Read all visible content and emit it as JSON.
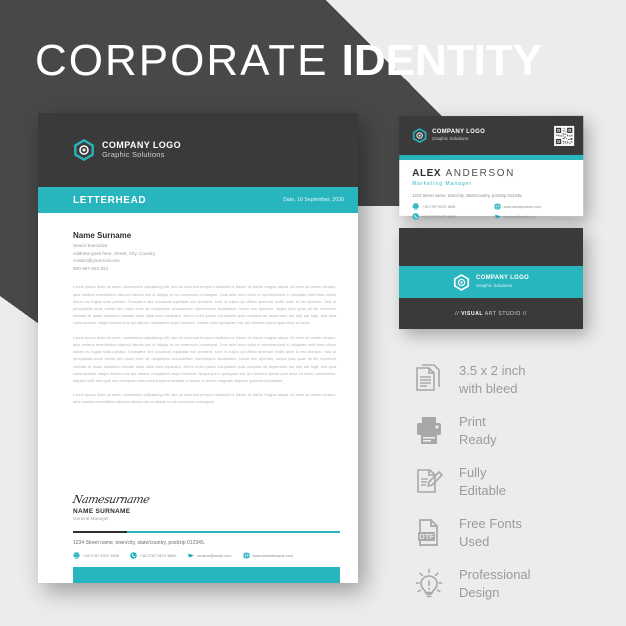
{
  "title": {
    "light": "CORPORATE",
    "bold": "IDENTITY"
  },
  "brand": {
    "accent": "#27b5be",
    "dark": "#3a3a3a",
    "background": "#484848",
    "logo_name": "COMPANY LOGO",
    "logo_tagline": "Graphic Solutions"
  },
  "letterhead": {
    "section_label": "LETTERHEAD",
    "date": "Date, 10 September, 2030",
    "recipient": {
      "name": "Name Surname",
      "role": "Senior Executive",
      "address": "Address goes here, Street, City, Country",
      "email": "contact@yourmail.com",
      "phone": "000-987-654-321"
    },
    "paragraphs": [
      "Lorem ipsum dolor sit amet, consectetur adipisicing elit, sed do eiusmod tempor incididunt ut labore et dolore magna aliqua. Ut enim ad minim veniam, quis nostrud exercitation ullamco laboris nisi ut aliquip ex ea commodo consequat. Duis aute irure dolor in reprehenderit in voluptate velit esse cillum dolore eu fugiat nulla pariatur. Excepteur sint occaecat cupidatat non proident, sunt in culpa qui officia deserunt mollit anim id est laborum. Sed ut perspiciatis unde omnis iste natus error sit voluptatem accusantium doloremque laudantium, totam rem aperiam, eaque ipsa quae ab illo inventore veritatis et quasi architecto beatae vitae dicta sunt explicabo. Nemo enim ipsam voluptatem quia voluptas sit aspernatur aut odit aut fugit, sed quia consequuntur magni dolores eos qui ratione voluptatem sequi nesciunt. Neque porro quisquam est, qui dolorem ipsum quia dolor sit amet.",
      "Lorem ipsum dolor sit amet, consectetur adipisicing elit, sed do eiusmod tempor incididunt ut labore et dolore magna aliqua. Ut enim ad minim veniam, quis nostrud exercitation ullamco laboris nisi ut aliquip ex ea commodo consequat. Duis aute irure dolor in reprehenderit in voluptate velit esse cillum dolore eu fugiat nulla pariatur. Excepteur sint occaecat cupidatat non proident, sunt in culpa qui officia deserunt mollit anim id est laborum. Sed ut perspiciatis unde omnis iste natus error sit voluptatem accusantium doloremque laudantium, totam rem aperiam, eaque ipsa quae ab illo inventore veritatis et quasi architecto beatae vitae dicta sunt explicabo. Nemo enim ipsam voluptatem quia voluptas sit aspernatur aut odit aut fugit, sed quia consequuntur magni dolores eos qui ratione voluptatem sequi nesciunt. Neque porro quisquam est, qui dolorem ipsum quia dolor sit amet, consectetur, adipisci velit, sed quia non numquam eius modi tempora incidunt ut labore et dolore magnam aliquam quaerat voluptatem.",
      "Lorem ipsum dolor sit amet, consectetur adipisicing elit, sed do eiusmod tempor incididunt ut labore et dolore magna aliqua. Ut enim ad minim veniam, quis nostrud exercitation ullamco laboris nisi ut aliquip ex ea commodo consequat."
    ],
    "signature": {
      "script": "Namesurname",
      "name": "NAME SURNAME",
      "role": "General Manager"
    },
    "footer": {
      "address": "1234 Street name, town/city, state/country, post/zip 012345.",
      "items": [
        {
          "icon": "fax-icon",
          "text": "+18 2767 9470 1808"
        },
        {
          "icon": "phone-icon",
          "text": "+18 2767 9470 1808"
        },
        {
          "icon": "email-icon",
          "text": "urname@email.com"
        },
        {
          "icon": "globe-icon",
          "text": "www.websitename.com"
        }
      ]
    }
  },
  "card_front": {
    "logo_name": "COMPANY LOGO",
    "logo_tagline": "Graphic Solutions",
    "first_name": "ALEX",
    "last_name": "ANDERSON",
    "role": "Marketing Manager",
    "address": "1234 Street name, town/city, state/country, post/zip 012345.",
    "items": [
      {
        "icon": "fax-icon",
        "text": "+18 2767 9470 1808"
      },
      {
        "icon": "globe-icon",
        "text": "www.websitename.com"
      },
      {
        "icon": "phone-icon",
        "text": "+18 2767 9470 1808"
      },
      {
        "icon": "email-icon",
        "text": "urname@email.com"
      }
    ]
  },
  "card_back": {
    "logo_name": "COMPANY LOGO",
    "logo_tagline": "Graphic Solutions",
    "tagline_pre": "// ",
    "tagline_bold": "VISUAL",
    "tagline_post": " ART STUDIO //"
  },
  "features": [
    {
      "icon": "document-icon",
      "line1": "3.5 x 2 inch",
      "line2": "with bleed"
    },
    {
      "icon": "printer-icon",
      "line1": "Print",
      "line2": "Ready"
    },
    {
      "icon": "edit-icon",
      "line1": "Fully",
      "line2": "Editable"
    },
    {
      "icon": "otf-font-icon",
      "line1": "Free Fonts",
      "line2": "Used"
    },
    {
      "icon": "lightbulb-icon",
      "line1": "Professional",
      "line2": "Design"
    }
  ]
}
